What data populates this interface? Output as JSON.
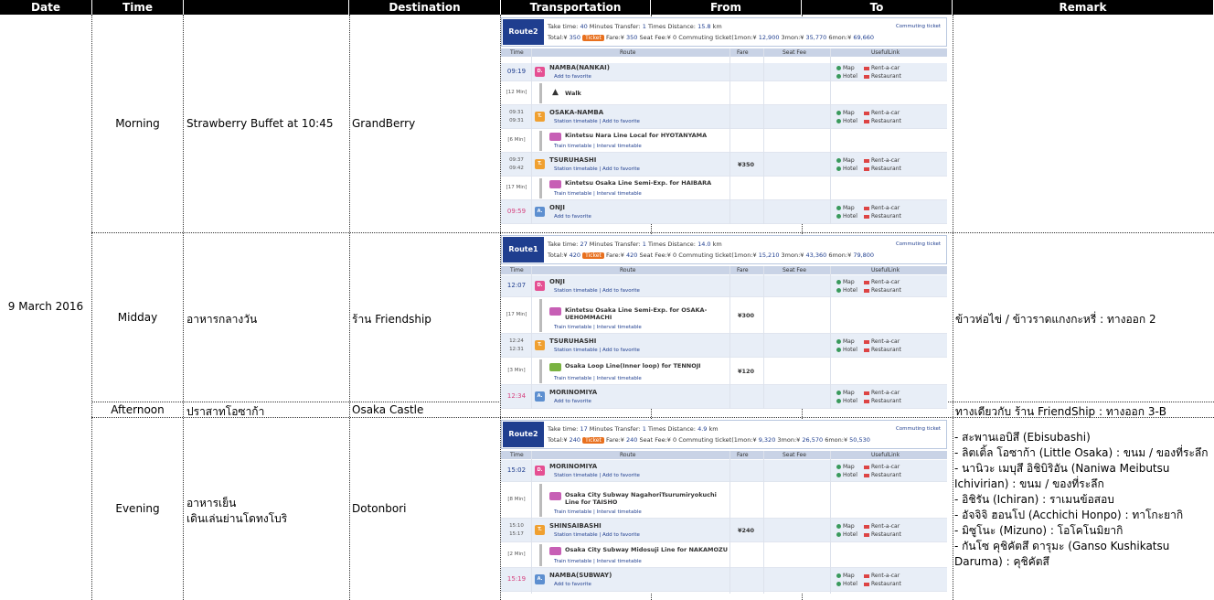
{
  "headers": {
    "date": "Date",
    "time": "Time",
    "destination_blank": "",
    "destination": "Destination",
    "transportation": "Transportation",
    "from": "From",
    "to": "To",
    "remark": "Remark"
  },
  "date": "9 March 2016",
  "rows": [
    {
      "time": "Morning",
      "plan": "Strawberry Buffet at 10:45",
      "destination": "GrandBerry",
      "remark": ""
    },
    {
      "time": "Midday",
      "plan": "อาหารกลางวัน",
      "destination": "ร้าน Friendship",
      "remark": "ข้าวห่อไข่ / ข้าวราดแกงกะหรี่ : ทางออก 2"
    },
    {
      "time": "Afternoon",
      "plan": "ปราสาทโอซาก้า",
      "destination": "Osaka Castle",
      "remark": "ทางเดียวกับ ร้าน FriendShip : ทางออก 3-B"
    },
    {
      "time": "Evening",
      "plan_line1": "อาหารเย็น",
      "plan_line2": "เดินเล่นย่านโดทงโบริ",
      "destination": "Dotonbori",
      "remark_items": [
        "- สะพานเอบิสึ (Ebisubashi)",
        "- ลิตเติ้ล โอซาก้า (Little Osaka) : ขนม / ของที่ระลึก",
        "- นานิวะ เมบุสึ อิชิบิริอัน (Naniwa Meibutsu Ichivirian) : ขนม / ของที่ระลึก",
        "- อิชิรัน (Ichiran) : ราเมนข้อสอบ",
        "- อัจจิจิ ฮอนโป (Acchichi Honpo) : ทาโกะยากิ",
        "- มิซูโนะ (Mizuno) : โอโคโนมิยากิ",
        "- กันโซ คุชิคัตสึ ดารุมะ (Ganso Kushikatsu Daruma) : คุชิคัตสึ"
      ]
    }
  ],
  "routes": [
    {
      "badge": "Route2",
      "take_time_label": "Take time:",
      "take_time": "40",
      "minutes": "Minutes",
      "transfer_label": "Transfer:",
      "transfer": "1",
      "times": "Times",
      "distance_label": "Distance:",
      "distance": "15.8",
      "km": "km",
      "total_label": "Total:¥",
      "total": "350",
      "ticket": "Ticket",
      "fare_text": "Fare:¥",
      "fare": "350",
      "seat_fee": "Seat Fee:¥",
      "seat_fee_val": "0",
      "commuting": "Commuting ticket(1mon:¥",
      "c1": "12,900",
      "c3_label": "3mon:¥",
      "c3": "35,770",
      "c6_label": "6mon:¥",
      "c6": "69,660",
      "commuting_link": "Commuting ticket",
      "cols": {
        "time": "Time",
        "route": "Route",
        "fare": "Fare",
        "seat": "Seat Fee",
        "useful": "UsefulLink"
      },
      "stops": [
        {
          "time": "09:19",
          "name": "NAMBA(NANKAI)",
          "sub": "Add to favorite",
          "icon": "D.",
          "color": "pinkbg"
        },
        {
          "duration": "[12 Min]",
          "line": "Walk",
          "kind": "walk"
        },
        {
          "time_a": "09:31",
          "time_b": "09:31",
          "name": "OSAKA-NAMBA",
          "sub": "Station timetable | Add to favorite",
          "icon": "T.",
          "color": "orgbg"
        },
        {
          "duration": "[6 Min]",
          "line": "Kintetsu Nara Line Local  for HYOTANYAMA",
          "sub": "Train timetable | Interval timetable",
          "kind": "train"
        },
        {
          "time_a": "09:37",
          "time_b": "09:42",
          "name": "TSURUHASHI",
          "sub": "Station timetable | Add to favorite",
          "icon": "T.",
          "color": "orgbg",
          "fare": "¥350"
        },
        {
          "duration": "[17 Min]",
          "line": "Kintetsu Osaka Line Semi-Exp.  for HAIBARA",
          "sub": "Train timetable | Interval timetable",
          "kind": "train"
        },
        {
          "time": "09:59",
          "name": "ONJI",
          "sub": "Add to favorite",
          "icon": "A.",
          "color": "bluebg",
          "pink": true
        }
      ]
    },
    {
      "badge": "Route1",
      "take_time_label": "Take time:",
      "take_time": "27",
      "minutes": "Minutes",
      "transfer_label": "Transfer:",
      "transfer": "1",
      "times": "Times",
      "distance_label": "Distance:",
      "distance": "14.0",
      "km": "km",
      "total_label": "Total:¥",
      "total": "420",
      "ticket": "Ticket",
      "fare_text": "Fare:¥",
      "fare": "420",
      "seat_fee": "Seat Fee:¥",
      "seat_fee_val": "0",
      "commuting": "Commuting ticket(1mon:¥",
      "c1": "15,210",
      "c3_label": "3mon:¥",
      "c3": "43,360",
      "c6_label": "6mon:¥",
      "c6": "79,800",
      "commuting_link": "Commuting ticket",
      "cols": {
        "time": "Time",
        "route": "Route",
        "fare": "Fare",
        "seat": "Seat Fee",
        "useful": "UsefulLink"
      },
      "stops": [
        {
          "time": "12:07",
          "name": "ONJI",
          "sub": "Station timetable | Add to favorite",
          "icon": "D.",
          "color": "pinkbg"
        },
        {
          "duration": "[17 Min]",
          "line": "Kintetsu Osaka Line Semi-Exp.  for OSAKA-UEHOMMACHI",
          "sub": "Train timetable | Interval timetable",
          "kind": "train",
          "fare": "¥300"
        },
        {
          "time_a": "12:24",
          "time_b": "12:31",
          "name": "TSURUHASHI",
          "sub": "Station timetable | Add to favorite",
          "icon": "T.",
          "color": "orgbg"
        },
        {
          "duration": "[3 Min]",
          "line": "Osaka Loop Line(Inner loop)  for TENNOJI",
          "sub": "Train timetable | Interval timetable",
          "kind": "train",
          "green": true,
          "fare": "¥120"
        },
        {
          "time": "12:34",
          "name": "MORINOMIYA",
          "sub": "Add to favorite",
          "icon": "A.",
          "color": "bluebg",
          "pink": true
        }
      ]
    },
    {
      "badge": "Route2",
      "take_time_label": "Take time:",
      "take_time": "17",
      "minutes": "Minutes",
      "transfer_label": "Transfer:",
      "transfer": "1",
      "times": "Times",
      "distance_label": "Distance:",
      "distance": "4.9",
      "km": "km",
      "total_label": "Total:¥",
      "total": "240",
      "ticket": "Ticket",
      "fare_text": "Fare:¥",
      "fare": "240",
      "seat_fee": "Seat Fee:¥",
      "seat_fee_val": "0",
      "commuting": "Commuting ticket(1mon:¥",
      "c1": "9,320",
      "c3_label": "3mon:¥",
      "c3": "26,570",
      "c6_label": "6mon:¥",
      "c6": "50,530",
      "commuting_link": "Commuting ticket",
      "cols": {
        "time": "Time",
        "route": "Route",
        "fare": "Fare",
        "seat": "Seat Fee",
        "useful": "UsefulLink"
      },
      "stops": [
        {
          "time": "15:02",
          "name": "MORINOMIYA",
          "sub": "Station timetable | Add to favorite",
          "icon": "D.",
          "color": "pinkbg"
        },
        {
          "duration": "[8 Min]",
          "line": "Osaka City Subway NagahoriTsurumiryokuchi Line  for TAISHO",
          "sub": "Train timetable | Interval timetable",
          "kind": "train"
        },
        {
          "time_a": "15:10",
          "time_b": "15:17",
          "name": "SHINSAIBASHI",
          "sub": "Station timetable | Add to favorite",
          "icon": "T.",
          "color": "orgbg",
          "fare": "¥240"
        },
        {
          "duration": "[2 Min]",
          "line": "Osaka City Subway Midosuji Line  for NAKAMOZU",
          "sub": "Train timetable | Interval timetable",
          "kind": "train"
        },
        {
          "time": "15:19",
          "name": "NAMBA(SUBWAY)",
          "sub": "Add to favorite",
          "icon": "A.",
          "color": "bluebg",
          "pink": true
        }
      ]
    }
  ],
  "useful_links": {
    "map": "Map",
    "hotel": "Hotel",
    "rent": "Rent-a-car",
    "restaurant": "Restaurant"
  }
}
